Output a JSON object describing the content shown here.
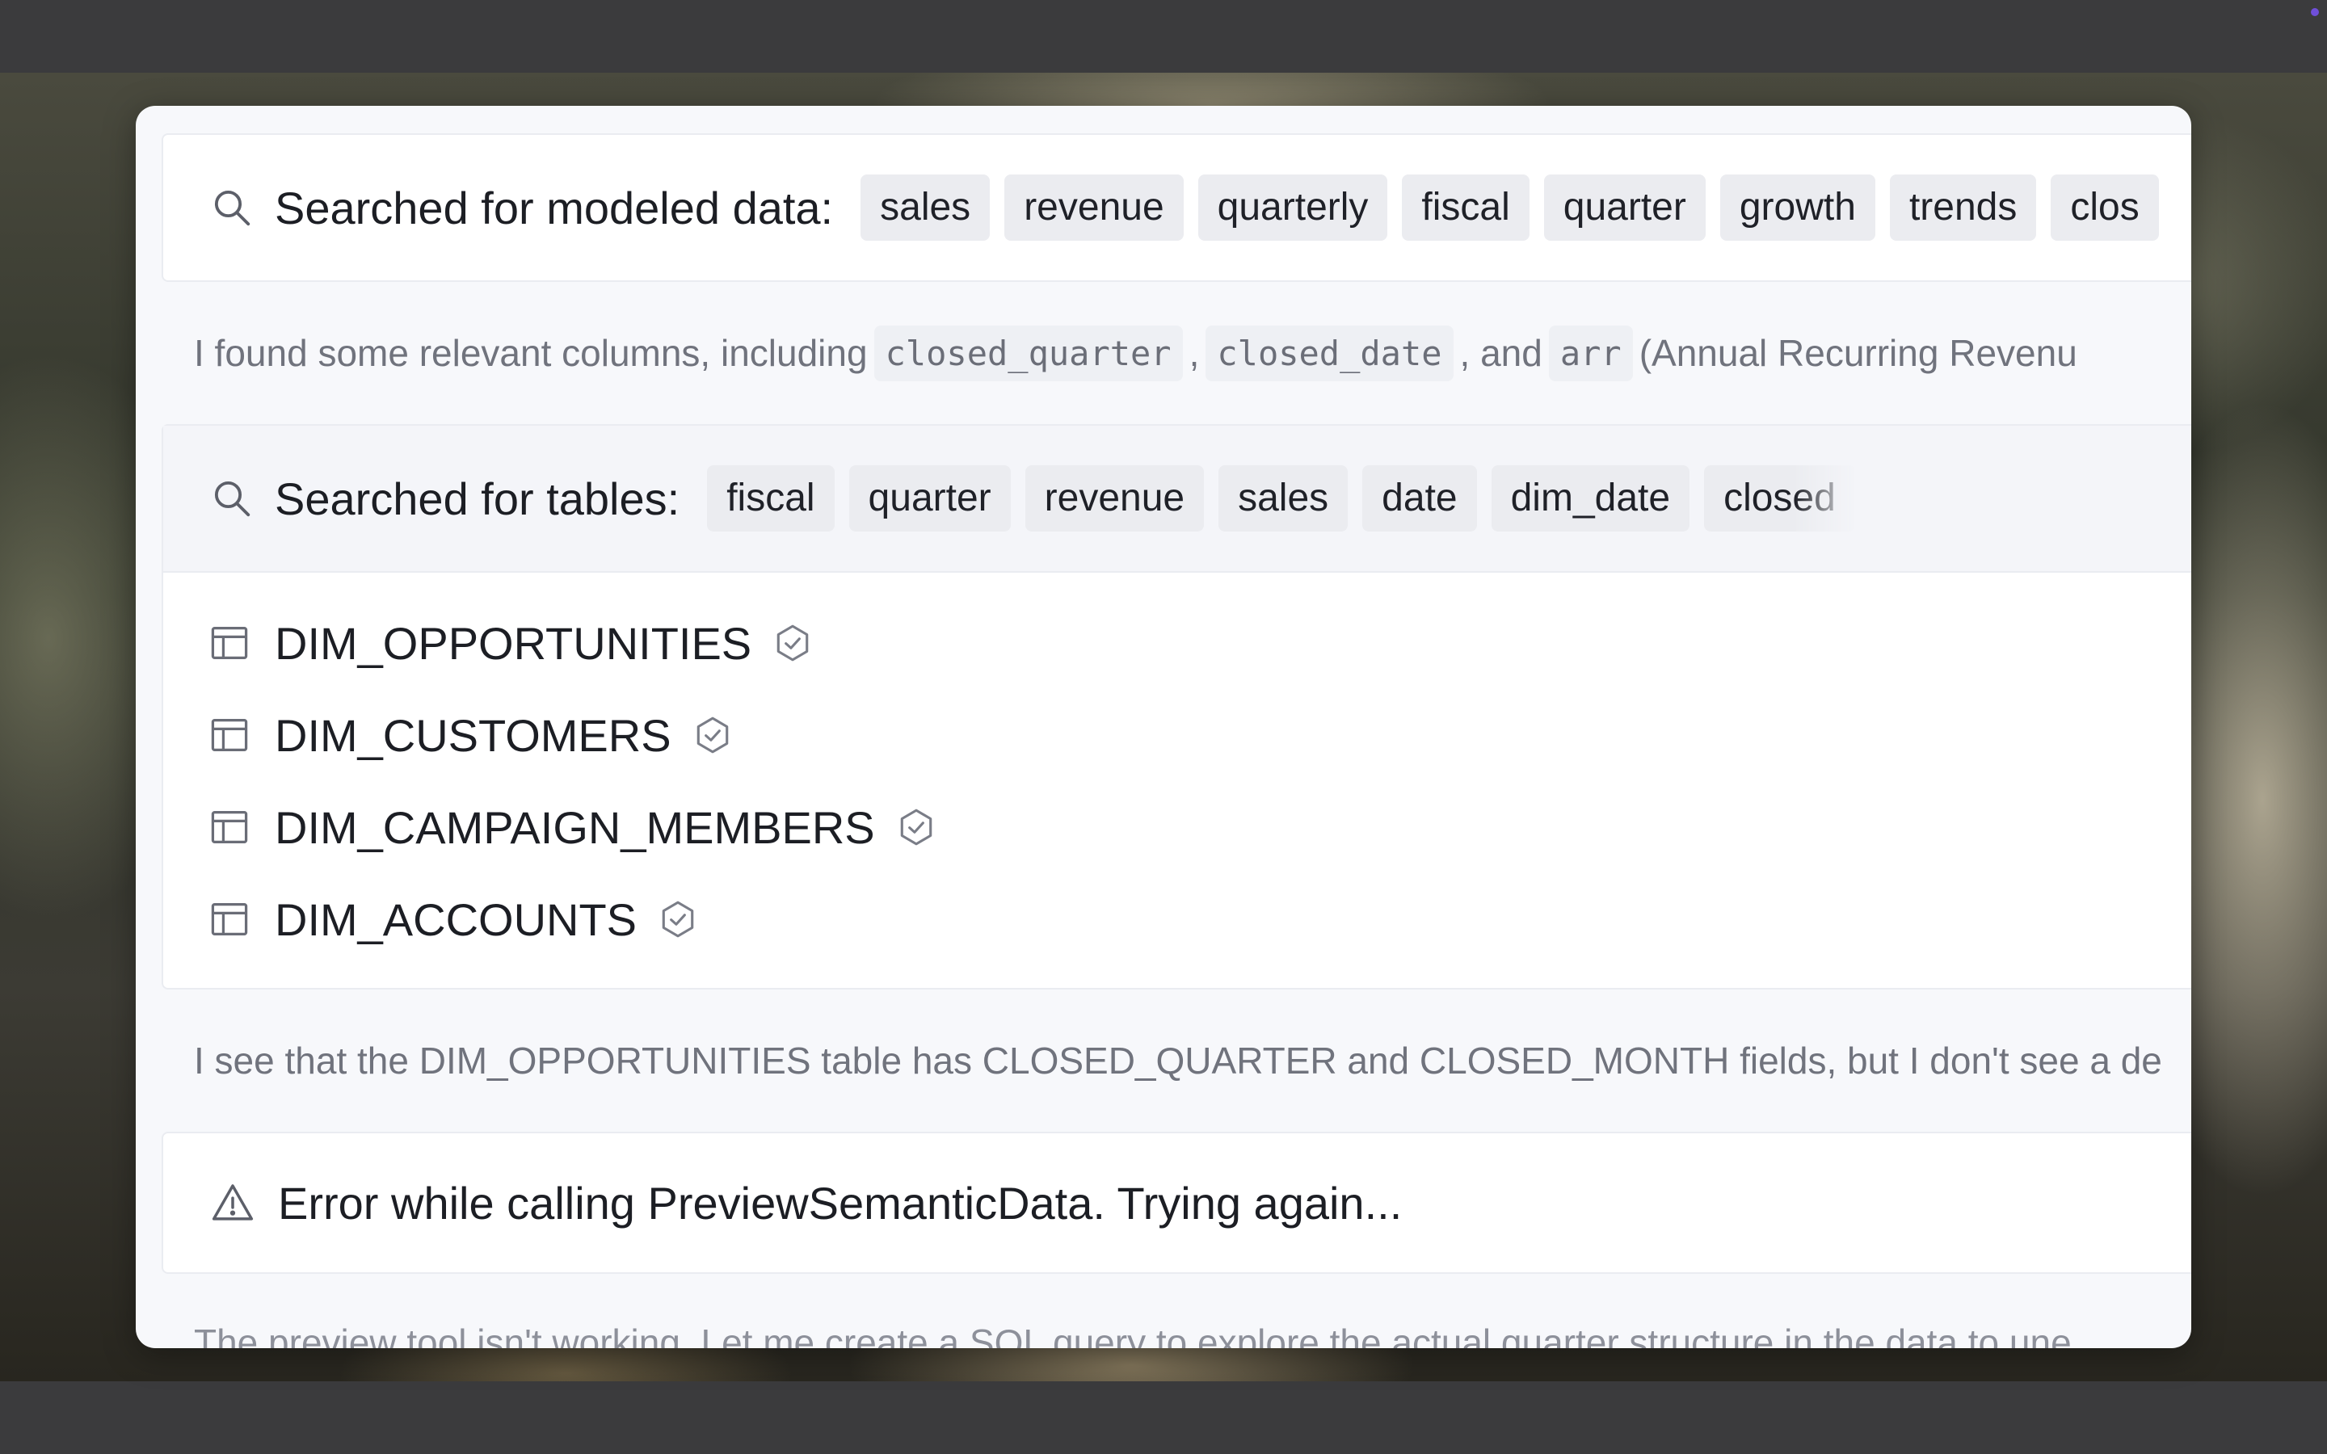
{
  "modeled_search": {
    "title": "Searched for modeled data:",
    "chips": [
      "sales",
      "revenue",
      "quarterly",
      "fiscal",
      "quarter",
      "growth",
      "trends",
      "clos"
    ]
  },
  "message_1": {
    "prefix": "I found some relevant columns, including",
    "code_1": "closed_quarter",
    "sep_1": ",",
    "code_2": "closed_date",
    "sep_2": ", and",
    "code_3": "arr",
    "suffix": "(Annual Recurring Revenu"
  },
  "tables_search": {
    "title": "Searched for tables:",
    "chips": [
      "fiscal",
      "quarter",
      "revenue",
      "sales",
      "date",
      "dim_date",
      "closed"
    ],
    "results": [
      "DIM_OPPORTUNITIES",
      "DIM_CUSTOMERS",
      "DIM_CAMPAIGN_MEMBERS",
      "DIM_ACCOUNTS"
    ]
  },
  "message_2": "I see that the DIM_OPPORTUNITIES table has CLOSED_QUARTER and CLOSED_MONTH fields, but I don't see a de",
  "error": "Error while calling PreviewSemanticData. Trying again...",
  "message_3": "The preview tool isn't working. Let me create a SQL query to explore the actual quarter structure in the data to une",
  "colors": {
    "panel": "#f7f8fb",
    "card": "#ffffff",
    "chip": "#ebecf0",
    "text": "#1c1e24",
    "muted": "#70737d"
  }
}
